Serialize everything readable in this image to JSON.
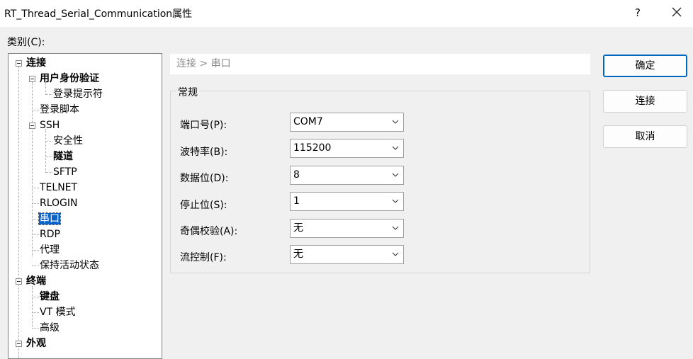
{
  "window": {
    "title": "RT_Thread_Serial_Communication属性",
    "help_label": "?"
  },
  "category_label": "类别(C):",
  "tree": {
    "items": [
      {
        "label": "连接"
      },
      {
        "label": "用户身份验证"
      },
      {
        "label": "登录提示符"
      },
      {
        "label": "登录脚本"
      },
      {
        "label": "SSH"
      },
      {
        "label": "安全性"
      },
      {
        "label": "隧道"
      },
      {
        "label": "SFTP"
      },
      {
        "label": "TELNET"
      },
      {
        "label": "RLOGIN"
      },
      {
        "label": "串口"
      },
      {
        "label": "RDP"
      },
      {
        "label": "代理"
      },
      {
        "label": "保持活动状态"
      },
      {
        "label": "终端"
      },
      {
        "label": "键盘"
      },
      {
        "label": "VT 模式"
      },
      {
        "label": "高级"
      },
      {
        "label": "外观"
      }
    ],
    "selected": "串口"
  },
  "breadcrumb": "连接 > 串口",
  "group": {
    "title": "常规",
    "fields": [
      {
        "label": "端口号(P):",
        "value": "COM7"
      },
      {
        "label": "波特率(B):",
        "value": "115200"
      },
      {
        "label": "数据位(D):",
        "value": "8"
      },
      {
        "label": "停止位(S):",
        "value": "1"
      },
      {
        "label": "奇偶校验(A):",
        "value": "无"
      },
      {
        "label": "流控制(F):",
        "value": "无"
      }
    ]
  },
  "buttons": {
    "ok": "确定",
    "connect": "连接",
    "cancel": "取消"
  },
  "colors": {
    "accent": "#0067c0",
    "selection": "#0a64c8"
  }
}
